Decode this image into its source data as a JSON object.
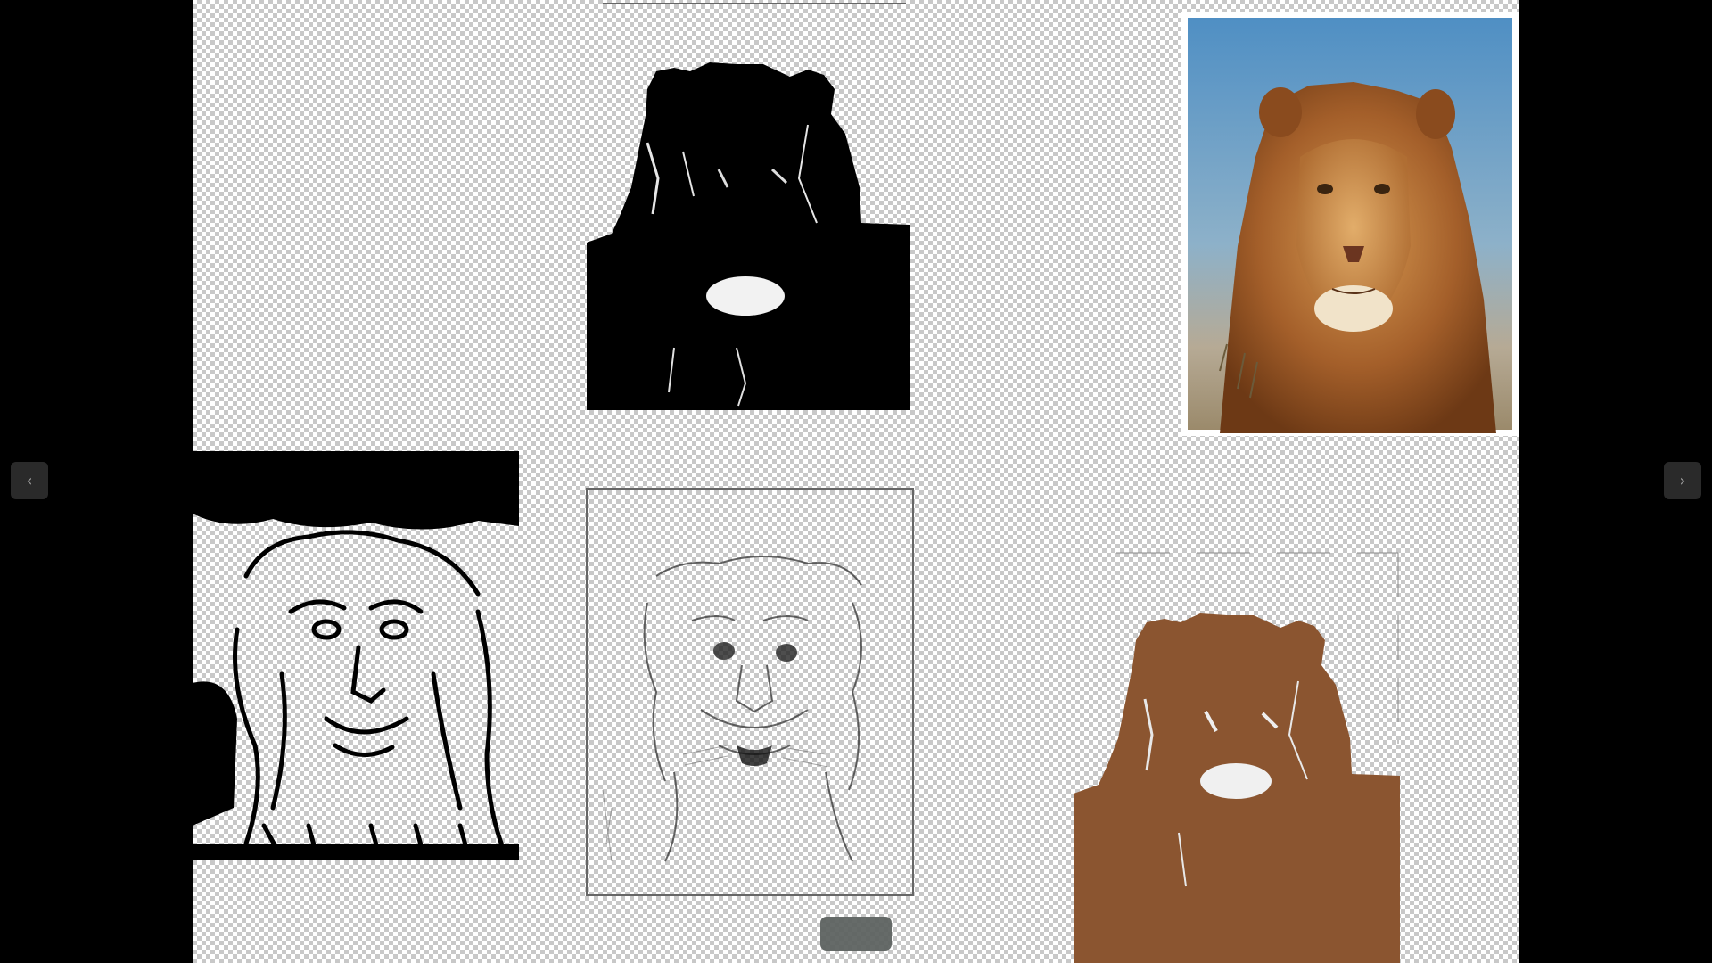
{
  "viewer": {
    "background": "#000000",
    "checker_color": "#c8c8c8",
    "accent_brown": "#8b5530"
  },
  "navigation": {
    "prev_icon": "chevron-left-icon",
    "next_icon": "chevron-right-icon",
    "prev_glyph": "‹",
    "next_glyph": "›"
  },
  "images": [
    {
      "name": "lion-black-silhouette",
      "style": "solid black threshold"
    },
    {
      "name": "lion-color-painting",
      "style": "full color painting"
    },
    {
      "name": "lion-black-outline",
      "style": "black line threshold"
    },
    {
      "name": "lion-pencil-sketch",
      "style": "light pencil sketch"
    },
    {
      "name": "lion-brown-silhouette",
      "style": "solid brown threshold"
    }
  ]
}
